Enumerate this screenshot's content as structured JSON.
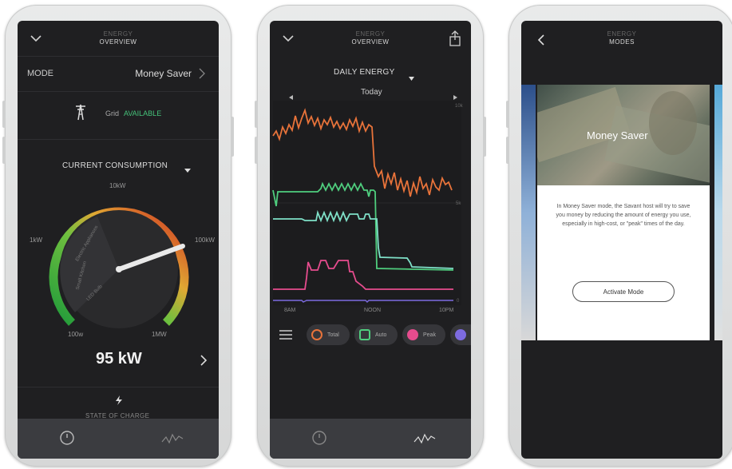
{
  "screen1": {
    "header": {
      "small": "ENERGY",
      "title": "OVERVIEW"
    },
    "mode_label": "MODE",
    "mode_value": "Money Saver",
    "grid_label": "Grid",
    "grid_status": "AVAILABLE",
    "consumption_label": "CURRENT CONSUMPTION",
    "gauge": {
      "top_label": "10kW",
      "left_label": "1kW",
      "right_label": "100kW",
      "bottom_left_label": "100w",
      "bottom_right_label": "1MW",
      "arc_labels": [
        "Electric Appliances",
        "Small Kitchen",
        "LED Bulb"
      ]
    },
    "value": "95 kW",
    "state_label": "STATE OF CHARGE"
  },
  "screen2": {
    "header": {
      "small": "ENERGY",
      "title": "OVERVIEW"
    },
    "dropdown": "DAILY ENERGY",
    "day": "Today",
    "y_labels": [
      "10k",
      "5k",
      "0"
    ],
    "x_labels": [
      "8AM",
      "NOON",
      "10PM"
    ],
    "chips": [
      "Total",
      "Auto",
      "Peak"
    ]
  },
  "screen3": {
    "header": {
      "small": "ENERGY",
      "title": "MODES"
    },
    "card_title": "Money Saver",
    "description": "In Money Saver mode, the Savant host will try to save you money by reducing the amount of energy you use, especially in high-cost, or \"peak\" times of the day.",
    "button": "Activate Mode"
  },
  "colors": {
    "accent_green": "#45c37a",
    "orange": "#e8733a",
    "green": "#4fce7e",
    "teal": "#7fe0c8",
    "pink": "#e64c8e",
    "purple": "#7d6be0"
  }
}
